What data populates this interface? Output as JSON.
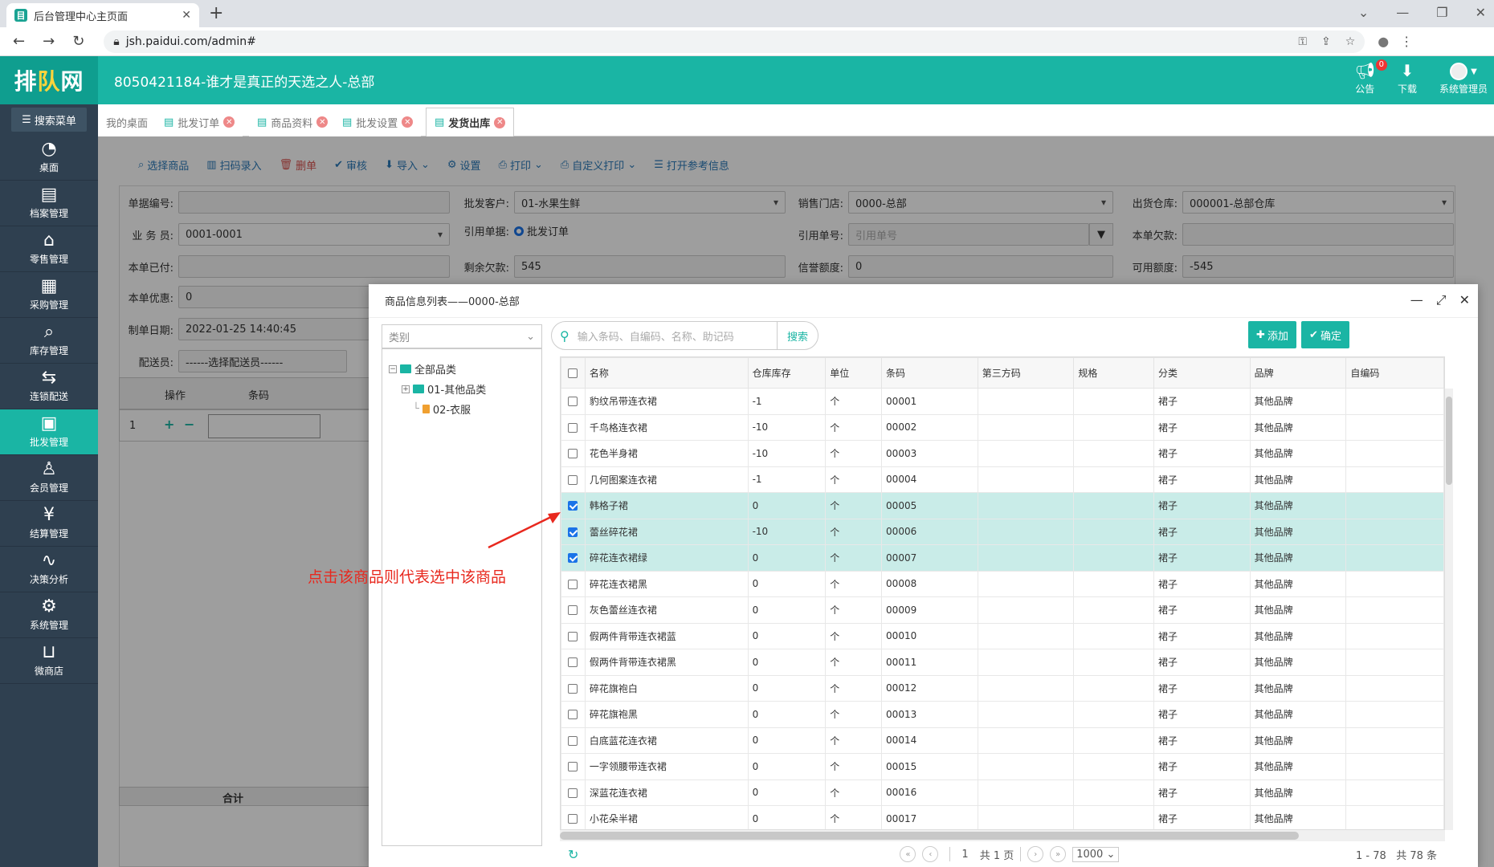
{
  "browser": {
    "tab_title": "后台管理中心主页面",
    "url": "jsh.paidui.com/admin#"
  },
  "header": {
    "logo": "排队网",
    "title": "8050421184-谁才是真正的天选之人-总部",
    "announce_label": "公告",
    "announce_badge": "0",
    "download_label": "下载",
    "user_label": "系统管理员"
  },
  "sidebar": {
    "search_label": "搜索菜单",
    "items": [
      {
        "label": "桌面",
        "icon": "dashboard-icon"
      },
      {
        "label": "档案管理",
        "icon": "archive-icon"
      },
      {
        "label": "零售管理",
        "icon": "store-icon"
      },
      {
        "label": "采购管理",
        "icon": "purchase-icon"
      },
      {
        "label": "库存管理",
        "icon": "inventory-icon"
      },
      {
        "label": "连锁配送",
        "icon": "delivery-icon"
      },
      {
        "label": "批发管理",
        "icon": "wholesale-icon"
      },
      {
        "label": "会员管理",
        "icon": "member-icon"
      },
      {
        "label": "结算管理",
        "icon": "settlement-icon"
      },
      {
        "label": "决策分析",
        "icon": "analysis-icon"
      },
      {
        "label": "系统管理",
        "icon": "settings-icon"
      },
      {
        "label": "微商店",
        "icon": "shop-icon"
      }
    ]
  },
  "page_tabs": [
    "我的桌面",
    "批发订单",
    "商品资料",
    "批发设置",
    "发货出库"
  ],
  "toolbar": [
    "选择商品",
    "扫码录入",
    "删单",
    "审核",
    "导入",
    "设置",
    "打印",
    "自定义打印",
    "打开参考信息"
  ],
  "form": {
    "bill_no_label": "单据编号:",
    "bill_no": "",
    "customer_label": "批发客户:",
    "customer": "01-水果生鲜",
    "store_label": "销售门店:",
    "store": "0000-总部",
    "warehouse_label": "出货仓库:",
    "warehouse": "000001-总部仓库",
    "staff_label": "业 务 员:",
    "staff": "0001-0001",
    "ref_bill_label": "引用单据:",
    "ref_bill_option": "批发订单",
    "ref_no_label": "引用单号:",
    "ref_no_placeholder": "引用单号",
    "owed_label": "本单欠款:",
    "owed": "",
    "paid_label": "本单已付:",
    "paid": "",
    "remaining_label": "剩余欠款:",
    "remaining": "545",
    "credit_label": "信誉额度:",
    "credit": "0",
    "available_label": "可用额度:",
    "available": "-545",
    "discount_label": "本单优惠:",
    "discount": "0",
    "date_label": "制单日期:",
    "date": "2022-01-25 14:40:45",
    "deliverer_label": "配送员:",
    "deliverer": "------选择配送员------"
  },
  "grid": {
    "op_header": "操作",
    "barcode_header": "条码",
    "row_no": "1",
    "total_label": "合计"
  },
  "modal": {
    "title": "商品信息列表——0000-总部",
    "category_placeholder": "类别",
    "tree": {
      "root": "全部品类",
      "children": [
        "01-其他品类",
        "02-衣服"
      ]
    },
    "search_placeholder": "输入条码、自编码、名称、助记码",
    "search_button": "搜索",
    "add_button": "添加",
    "confirm_button": "确定",
    "columns": [
      "名称",
      "仓库库存",
      "单位",
      "条码",
      "第三方码",
      "规格",
      "分类",
      "品牌",
      "自编码"
    ],
    "rows": [
      {
        "name": "豹纹吊带连衣裙",
        "stock": "-1",
        "unit": "个",
        "code": "00001",
        "cat": "裙子",
        "brand": "其他品牌",
        "checked": false
      },
      {
        "name": "千鸟格连衣裙",
        "stock": "-10",
        "unit": "个",
        "code": "00002",
        "cat": "裙子",
        "brand": "其他品牌",
        "checked": false
      },
      {
        "name": "花色半身裙",
        "stock": "-10",
        "unit": "个",
        "code": "00003",
        "cat": "裙子",
        "brand": "其他品牌",
        "checked": false
      },
      {
        "name": "几何图案连衣裙",
        "stock": "-1",
        "unit": "个",
        "code": "00004",
        "cat": "裙子",
        "brand": "其他品牌",
        "checked": false
      },
      {
        "name": "韩格子裙",
        "stock": "0",
        "unit": "个",
        "code": "00005",
        "cat": "裙子",
        "brand": "其他品牌",
        "checked": true
      },
      {
        "name": "蕾丝碎花裙",
        "stock": "-10",
        "unit": "个",
        "code": "00006",
        "cat": "裙子",
        "brand": "其他品牌",
        "checked": true
      },
      {
        "name": "碎花连衣裙绿",
        "stock": "0",
        "unit": "个",
        "code": "00007",
        "cat": "裙子",
        "brand": "其他品牌",
        "checked": true
      },
      {
        "name": "碎花连衣裙黑",
        "stock": "0",
        "unit": "个",
        "code": "00008",
        "cat": "裙子",
        "brand": "其他品牌",
        "checked": false
      },
      {
        "name": "灰色蕾丝连衣裙",
        "stock": "0",
        "unit": "个",
        "code": "00009",
        "cat": "裙子",
        "brand": "其他品牌",
        "checked": false
      },
      {
        "name": "假两件背带连衣裙蓝",
        "stock": "0",
        "unit": "个",
        "code": "00010",
        "cat": "裙子",
        "brand": "其他品牌",
        "checked": false
      },
      {
        "name": "假两件背带连衣裙黑",
        "stock": "0",
        "unit": "个",
        "code": "00011",
        "cat": "裙子",
        "brand": "其他品牌",
        "checked": false
      },
      {
        "name": "碎花旗袍白",
        "stock": "0",
        "unit": "个",
        "code": "00012",
        "cat": "裙子",
        "brand": "其他品牌",
        "checked": false
      },
      {
        "name": "碎花旗袍黑",
        "stock": "0",
        "unit": "个",
        "code": "00013",
        "cat": "裙子",
        "brand": "其他品牌",
        "checked": false
      },
      {
        "name": "白底蓝花连衣裙",
        "stock": "0",
        "unit": "个",
        "code": "00014",
        "cat": "裙子",
        "brand": "其他品牌",
        "checked": false
      },
      {
        "name": "一字领腰带连衣裙",
        "stock": "0",
        "unit": "个",
        "code": "00015",
        "cat": "裙子",
        "brand": "其他品牌",
        "checked": false
      },
      {
        "name": "深蓝花连衣裙",
        "stock": "0",
        "unit": "个",
        "code": "00016",
        "cat": "裙子",
        "brand": "其他品牌",
        "checked": false
      },
      {
        "name": "小花朵半裙",
        "stock": "0",
        "unit": "个",
        "code": "00017",
        "cat": "裙子",
        "brand": "其他品牌",
        "checked": false
      }
    ],
    "pager": {
      "page": "1",
      "total_pages": "共 1 页",
      "page_size": "1000",
      "range": "1 - 78",
      "total": "共 78 条"
    }
  },
  "annotation": "点击该商品则代表选中该商品",
  "colors": {
    "accent": "#1ab5a4",
    "sidebar": "#2f4050",
    "annotation": "#e8281e",
    "selected_row": "#c9ece8"
  }
}
